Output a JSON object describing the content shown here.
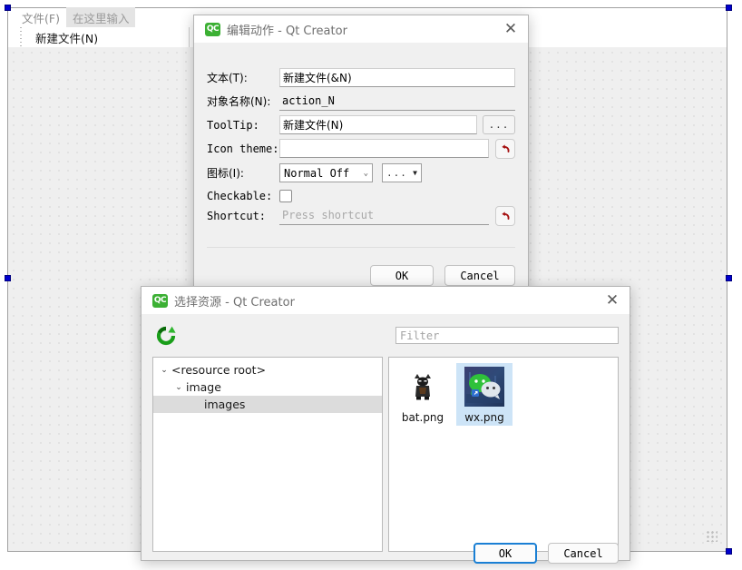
{
  "designer": {
    "menubar": {
      "items": [
        {
          "label": "文件(F)",
          "placeholder": false
        },
        {
          "label": "在这里输入",
          "placeholder": true
        }
      ]
    },
    "menu_popup": {
      "item_label": "新建文件(N)"
    },
    "selection_handle_color": "#0000cd"
  },
  "edit_action_dialog": {
    "title": "编辑动作 - Qt Creator",
    "logo_text": "QC",
    "close_icon": "✕",
    "fields": {
      "text_label": "文本(T):",
      "text_value": "新建文件(&N)",
      "object_name_label": "对象名称(N):",
      "object_name_value": "action_N",
      "tooltip_label": "ToolTip:",
      "tooltip_value": "新建文件(N)",
      "tooltip_browse": "...",
      "icon_theme_label": "Icon theme:",
      "icon_theme_value": "",
      "icon_label": "图标(I):",
      "icon_state_value": "Normal Off",
      "icon_browse": "...",
      "checkable_label": "Checkable:",
      "checkable_checked": false,
      "shortcut_label": "Shortcut:",
      "shortcut_placeholder": "Press shortcut"
    },
    "buttons": {
      "ok": "OK",
      "cancel": "Cancel"
    }
  },
  "choose_resource_dialog": {
    "title": "选择资源 - Qt Creator",
    "logo_text": "QC",
    "close_icon": "✕",
    "filter_placeholder": "Filter",
    "tree": [
      {
        "label": "<resource root>",
        "indent": 0,
        "twisty": "⌄",
        "selected": false
      },
      {
        "label": "image",
        "indent": 1,
        "twisty": "⌄",
        "selected": false
      },
      {
        "label": "images",
        "indent": 2,
        "twisty": "",
        "selected": true
      }
    ],
    "files": [
      {
        "name": "bat.png",
        "selected": false,
        "icon": "bat-thumbnail"
      },
      {
        "name": "wx.png",
        "selected": true,
        "icon": "wechat-thumbnail"
      }
    ],
    "buttons": {
      "ok": "OK",
      "cancel": "Cancel"
    }
  }
}
